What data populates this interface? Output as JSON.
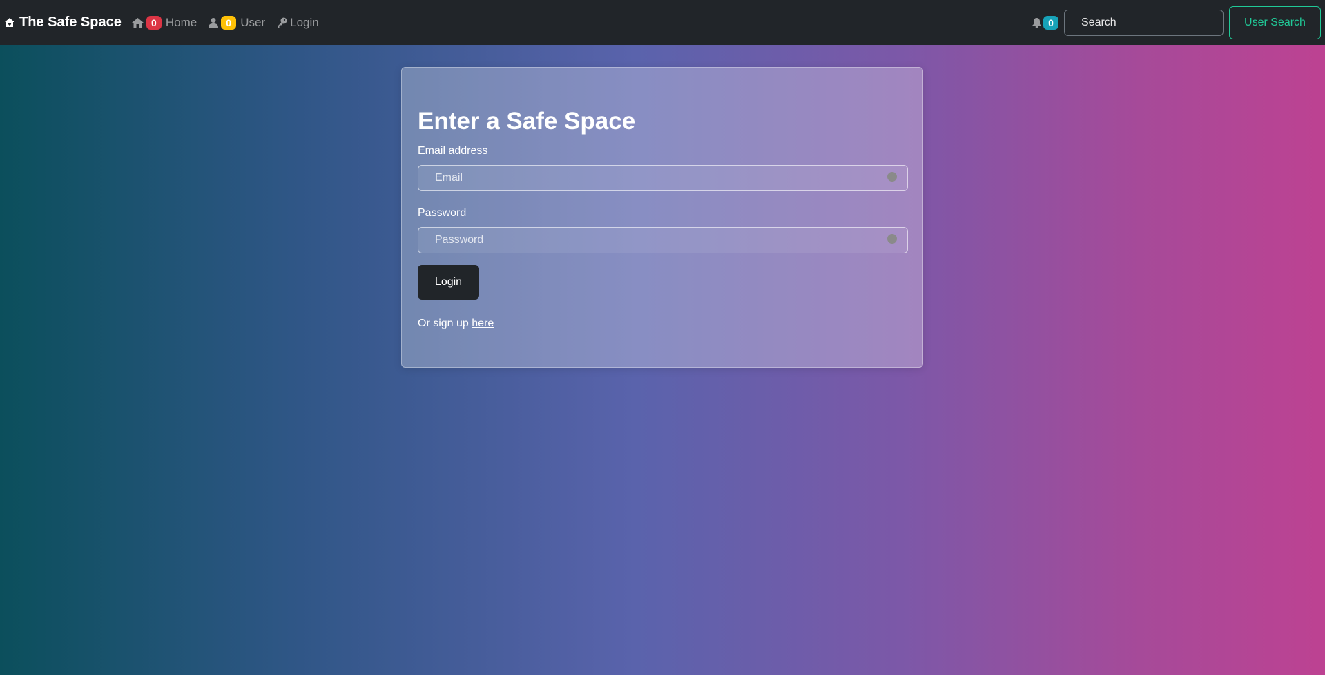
{
  "navbar": {
    "brand": "The Safe Space",
    "brand_icon": "house-heart-icon",
    "links": [
      {
        "label": "Home",
        "icon": "house-icon",
        "badge": "0",
        "badge_color": "#dc3545"
      },
      {
        "label": "User",
        "icon": "person-icon",
        "badge": "0",
        "badge_color": "#ffc107"
      },
      {
        "label": "Login",
        "icon": "key-icon"
      }
    ],
    "notifications": {
      "icon": "bell-icon",
      "count": "0",
      "badge_color": "#17a2b8"
    },
    "search": {
      "placeholder": "Search"
    },
    "search_button": "User Search"
  },
  "login_card": {
    "title": "Enter a Safe Space",
    "email_label": "Email address",
    "email_placeholder": "Email",
    "password_label": "Password",
    "password_placeholder": "Password",
    "submit_label": "Login",
    "signup_prefix": "Or sign up",
    "signup_link": "here"
  },
  "colors": {
    "navbar_bg": "#212529",
    "search_button_accent": "#20c997",
    "gradient_start": "#0b4f5c",
    "gradient_end": "#bd4292"
  }
}
